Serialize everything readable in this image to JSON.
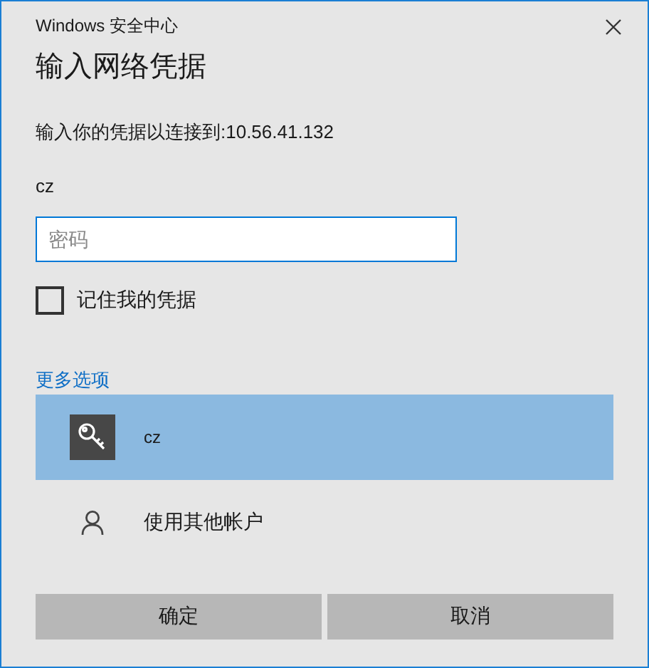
{
  "window": {
    "title": "Windows 安全中心"
  },
  "heading": "输入网络凭据",
  "prompt": "输入你的凭据以连接到:10.56.41.132",
  "username": "cz",
  "password_field": {
    "placeholder": "密码"
  },
  "remember": {
    "label": "记住我的凭据",
    "checked": false
  },
  "more_options_link": "更多选项",
  "accounts": [
    {
      "kind": "credential",
      "label": "cz",
      "selected": true
    },
    {
      "kind": "other",
      "label": "使用其他帐户",
      "selected": false
    }
  ],
  "buttons": [
    "确定",
    "取消"
  ]
}
